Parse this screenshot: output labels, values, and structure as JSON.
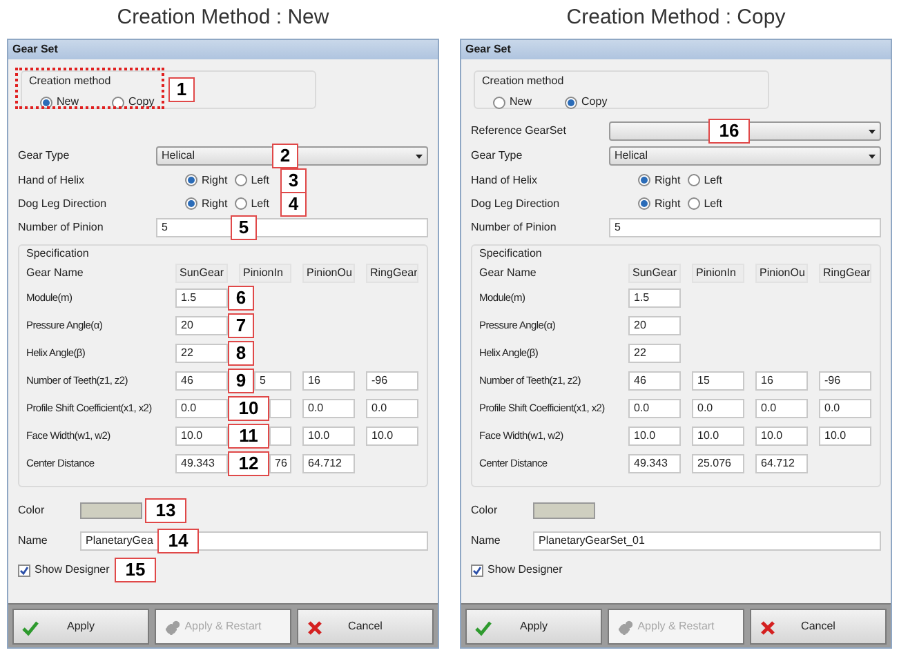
{
  "figures": [
    {
      "caption": "Creation Method : New",
      "window": {
        "title": "Gear Set"
      },
      "creation_method": {
        "label": "Creation method",
        "highlighted": true,
        "callout": "1",
        "options": [
          {
            "label": "New",
            "selected": true
          },
          {
            "label": "Copy",
            "selected": false
          }
        ]
      },
      "gear_type": {
        "label": "Gear Type",
        "value": "Helical",
        "callout": "2"
      },
      "hand_of_helix": {
        "label": "Hand of Helix",
        "callout": "3",
        "options": [
          {
            "label": "Right",
            "selected": true
          },
          {
            "label": "Left",
            "selected": false
          }
        ]
      },
      "dog_leg_direction": {
        "label": "Dog Leg Direction",
        "callout": "4",
        "options": [
          {
            "label": "Right",
            "selected": true
          },
          {
            "label": "Left",
            "selected": false
          }
        ]
      },
      "number_of_pinion": {
        "label": "Number of Pinion",
        "value": "5",
        "callout": "5"
      },
      "specification": {
        "title": "Specification",
        "header": {
          "label": "Gear Name",
          "cells": [
            "SunGear",
            "PinionIn",
            "PinionOu",
            "RingGear"
          ]
        },
        "rows": [
          {
            "label": "Module(m)",
            "cells": [
              "1.5"
            ],
            "callout": "6"
          },
          {
            "label": "Pressure Angle(α)",
            "cells": [
              "20"
            ],
            "callout": "7"
          },
          {
            "label": "Helix Angle(β)",
            "cells": [
              "22"
            ],
            "callout": "8"
          },
          {
            "label": "Number of Teeth(z1, z2)",
            "cells": [
              "46",
              "5",
              "16",
              "-96"
            ],
            "callout": "9"
          },
          {
            "label": "Profile Shift Coefficient(x1, x2)",
            "cells": [
              "0.0",
              null,
              "0.0",
              "0.0"
            ],
            "callout": "10"
          },
          {
            "label": "Face Width(w1, w2)",
            "cells": [
              "10.0",
              null,
              "10.0",
              "10.0"
            ],
            "callout": "11"
          },
          {
            "label": "Center Distance",
            "cells": [
              "49.343",
              "76",
              "64.712"
            ],
            "callout": "12"
          }
        ]
      },
      "color": {
        "label": "Color",
        "callout": "13"
      },
      "name": {
        "label": "Name",
        "value": "PlanetaryGea",
        "callout": "14"
      },
      "show_designer": {
        "label": "Show Designer",
        "checked": true,
        "callout": "15"
      },
      "buttons": [
        {
          "label": "Apply",
          "kind": "apply",
          "disabled": false
        },
        {
          "label": "Apply & Restart",
          "kind": "restart",
          "disabled": true
        },
        {
          "label": "Cancel",
          "kind": "cancel",
          "disabled": false
        }
      ]
    },
    {
      "caption": "Creation Method : Copy",
      "window": {
        "title": "Gear Set"
      },
      "creation_method": {
        "label": "Creation method",
        "options": [
          {
            "label": "New",
            "selected": false
          },
          {
            "label": "Copy",
            "selected": true
          }
        ]
      },
      "reference_gearset": {
        "label": "Reference GearSet",
        "callout": "16"
      },
      "gear_type": {
        "label": "Gear Type",
        "value": "Helical"
      },
      "hand_of_helix": {
        "label": "Hand of Helix",
        "options": [
          {
            "label": "Right",
            "selected": true
          },
          {
            "label": "Left",
            "selected": false
          }
        ]
      },
      "dog_leg_direction": {
        "label": "Dog Leg Direction",
        "options": [
          {
            "label": "Right",
            "selected": true
          },
          {
            "label": "Left",
            "selected": false
          }
        ]
      },
      "number_of_pinion": {
        "label": "Number of Pinion",
        "value": "5"
      },
      "specification": {
        "title": "Specification",
        "header": {
          "label": "Gear Name",
          "cells": [
            "SunGear",
            "PinionIn",
            "PinionOu",
            "RingGear"
          ]
        },
        "rows": [
          {
            "label": "Module(m)",
            "cells": [
              "1.5"
            ]
          },
          {
            "label": "Pressure Angle(α)",
            "cells": [
              "20"
            ]
          },
          {
            "label": "Helix Angle(β)",
            "cells": [
              "22"
            ]
          },
          {
            "label": "Number of Teeth(z1, z2)",
            "cells": [
              "46",
              "15",
              "16",
              "-96"
            ]
          },
          {
            "label": "Profile Shift Coefficient(x1, x2)",
            "cells": [
              "0.0",
              "0.0",
              "0.0",
              "0.0"
            ]
          },
          {
            "label": "Face Width(w1, w2)",
            "cells": [
              "10.0",
              "10.0",
              "10.0",
              "10.0"
            ]
          },
          {
            "label": "Center Distance",
            "cells": [
              "49.343",
              "25.076",
              "64.712"
            ]
          }
        ]
      },
      "color": {
        "label": "Color"
      },
      "name": {
        "label": "Name",
        "value": "PlanetaryGearSet_01"
      },
      "show_designer": {
        "label": "Show Designer",
        "checked": true
      },
      "buttons": [
        {
          "label": "Apply",
          "kind": "apply",
          "disabled": false
        },
        {
          "label": "Apply & Restart",
          "kind": "restart",
          "disabled": true
        },
        {
          "label": "Cancel",
          "kind": "cancel",
          "disabled": false
        }
      ]
    }
  ]
}
